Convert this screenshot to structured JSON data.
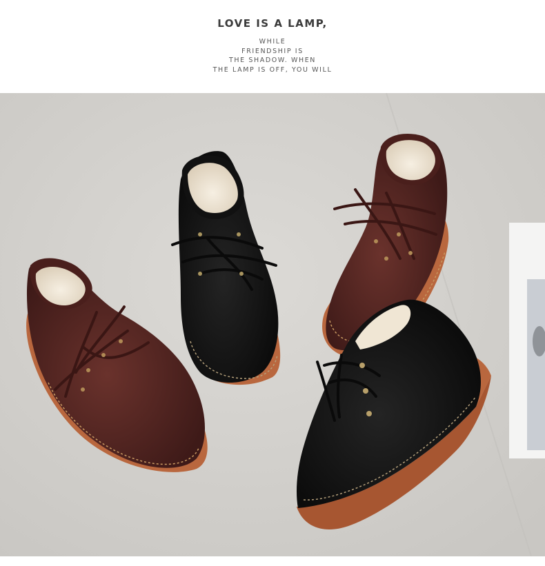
{
  "header": {
    "title": "LOVE IS A LAMP,",
    "subtitle_lines": [
      "WHILE",
      "FRIENDSHIP IS",
      "THE SHADOW. WHEN",
      "THE LAMP IS OFF, YOU WILL"
    ]
  },
  "photo": {
    "subject": "four suede lace-up ankle boots with fleece lining",
    "colors": {
      "background": "#d7d5d1",
      "brown_suede": "#5a2a26",
      "black_suede": "#151515",
      "fleece": "#efe6d6",
      "sole": "#b9673e"
    }
  }
}
